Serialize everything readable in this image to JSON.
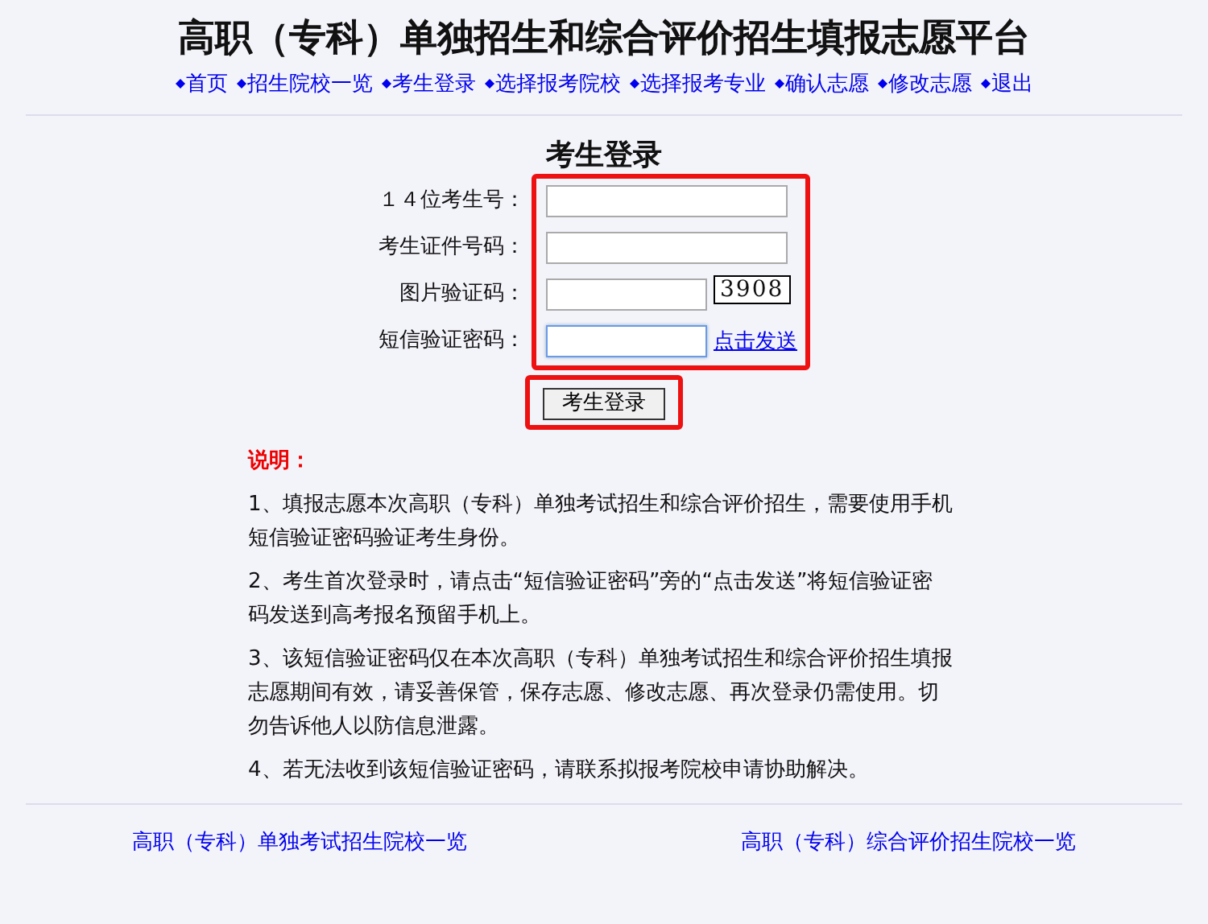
{
  "title": "高职（专科）单独招生和综合评价招生填报志愿平台",
  "nav": [
    {
      "label": "首页"
    },
    {
      "label": "招生院校一览"
    },
    {
      "label": "考生登录"
    },
    {
      "label": "选择报考院校"
    },
    {
      "label": "选择报考专业"
    },
    {
      "label": "确认志愿"
    },
    {
      "label": "修改志愿"
    },
    {
      "label": "退出"
    }
  ],
  "login": {
    "heading": "考生登录",
    "highlighted": true,
    "fields": [
      {
        "kind": "text",
        "label": "１４位考生号：",
        "focused": false
      },
      {
        "kind": "text",
        "label": "考生证件号码：",
        "focused": false
      },
      {
        "kind": "captcha",
        "label": "图片验证码：",
        "focused": false,
        "captcha": "3908"
      },
      {
        "kind": "sms",
        "label": "短信验证密码：",
        "focused": true,
        "link": "点击发送"
      }
    ],
    "button": {
      "label": "考生登录",
      "highlighted": true
    }
  },
  "notes": {
    "heading": "说明：",
    "items": [
      "1、填报志愿本次高职（专科）单独考试招生和综合评价招生，需要使用手机短信验证密码验证考生身份。",
      "2、考生首次登录时，请点击“短信验证密码”旁的“点击发送”将短信验证密码发送到高考报名预留手机上。",
      "3、该短信验证密码仅在本次高职（专科）单独考试招生和综合评价招生填报志愿期间有效，请妥善保管，保存志愿、修改志愿、再次登录仍需使用。切勿告诉他人以防信息泄露。",
      "4、若无法收到该短信验证密码，请联系拟报考院校申请协助解决。"
    ]
  },
  "footer": [
    "高职（专科）单独考试招生院校一览",
    "高职（专科）综合评价招生院校一览"
  ]
}
